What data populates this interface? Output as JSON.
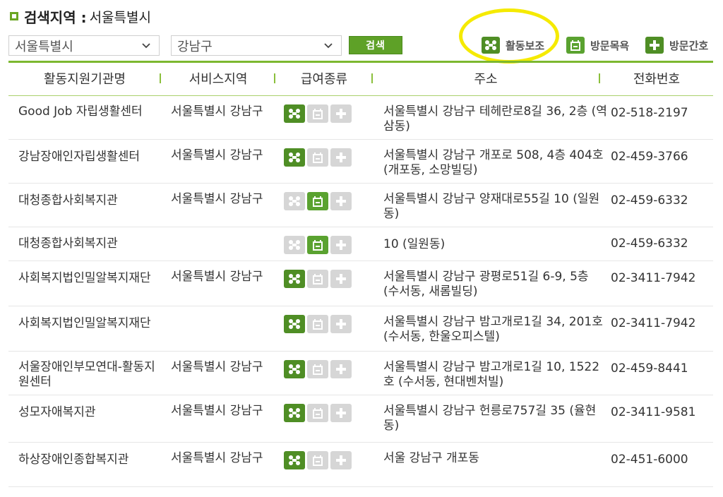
{
  "header": {
    "title": "검색지역 :",
    "region": "서울특별시"
  },
  "filters": {
    "city": "서울특별시",
    "district": "강남구",
    "search_label": "검색"
  },
  "legend": [
    {
      "label": "활동보조",
      "icon": "activity-support-icon"
    },
    {
      "label": "방문목욕",
      "icon": "bath-icon"
    },
    {
      "label": "방문간호",
      "icon": "plus-icon"
    }
  ],
  "table": {
    "headers": [
      "활동지원기관명",
      "서비스지역",
      "급여종류",
      "주소",
      "전화번호"
    ],
    "rows": [
      {
        "name": "Good Job 자립생활센터",
        "area": "서울특별시 강남구",
        "services": [
          true,
          false,
          false
        ],
        "address": "서울특별시 강남구 테헤란로8길 36, 2층 (역삼동)",
        "phone": "02-518-2197"
      },
      {
        "name": "강남장애인자립생활센터",
        "area": "서울특별시 강남구",
        "services": [
          true,
          false,
          false
        ],
        "address": "서울특별시 강남구 개포로 508, 4층 404호 (개포동, 소망빌딩)",
        "phone": "02-459-3766"
      },
      {
        "name": "대청종합사회복지관",
        "area": "서울특별시 강남구",
        "services": [
          false,
          true,
          false
        ],
        "address": "서울특별시 강남구 양재대로55길 10 (일원동)",
        "phone": "02-459-6332"
      },
      {
        "name": "대청종합사회복지관",
        "area": "",
        "services": [
          false,
          true,
          false
        ],
        "address": "10 (일원동)",
        "phone": "02-459-6332"
      },
      {
        "name": "사회복지법인밀알복지재단",
        "area": "서울특별시 강남구",
        "services": [
          true,
          false,
          false
        ],
        "address": "서울특별시 강남구 광평로51길 6-9, 5층 (수서동, 새롬빌딩)",
        "phone": "02-3411-7942"
      },
      {
        "name": "사회복지법인밀알복지재단",
        "area": "",
        "services": [
          true,
          false,
          false
        ],
        "address": "서울특별시 강남구 밤고개로1길 34, 201호 (수서동, 한울오피스텔)",
        "phone": "02-3411-7942"
      },
      {
        "name": "서울장애인부모연대-활동지원센터",
        "area": "서울특별시 강남구",
        "services": [
          true,
          false,
          false
        ],
        "address": "서울특별시 강남구 밤고개로1길 10, 1522호 (수서동, 현대벤처빌)",
        "phone": "02-459-8441"
      },
      {
        "name": "성모자애복지관",
        "area": "서울특별시 강남구",
        "services": [
          true,
          false,
          false
        ],
        "address": "서울특별시 강남구 헌릉로757길 35 (율현동)",
        "phone": "02-3411-9581"
      },
      {
        "name": "하상장애인종합복지관",
        "area": "서울특별시 강남구",
        "services": [
          true,
          false,
          false
        ],
        "address": "서울 강남구 개포동",
        "phone": "02-451-6000"
      }
    ]
  }
}
